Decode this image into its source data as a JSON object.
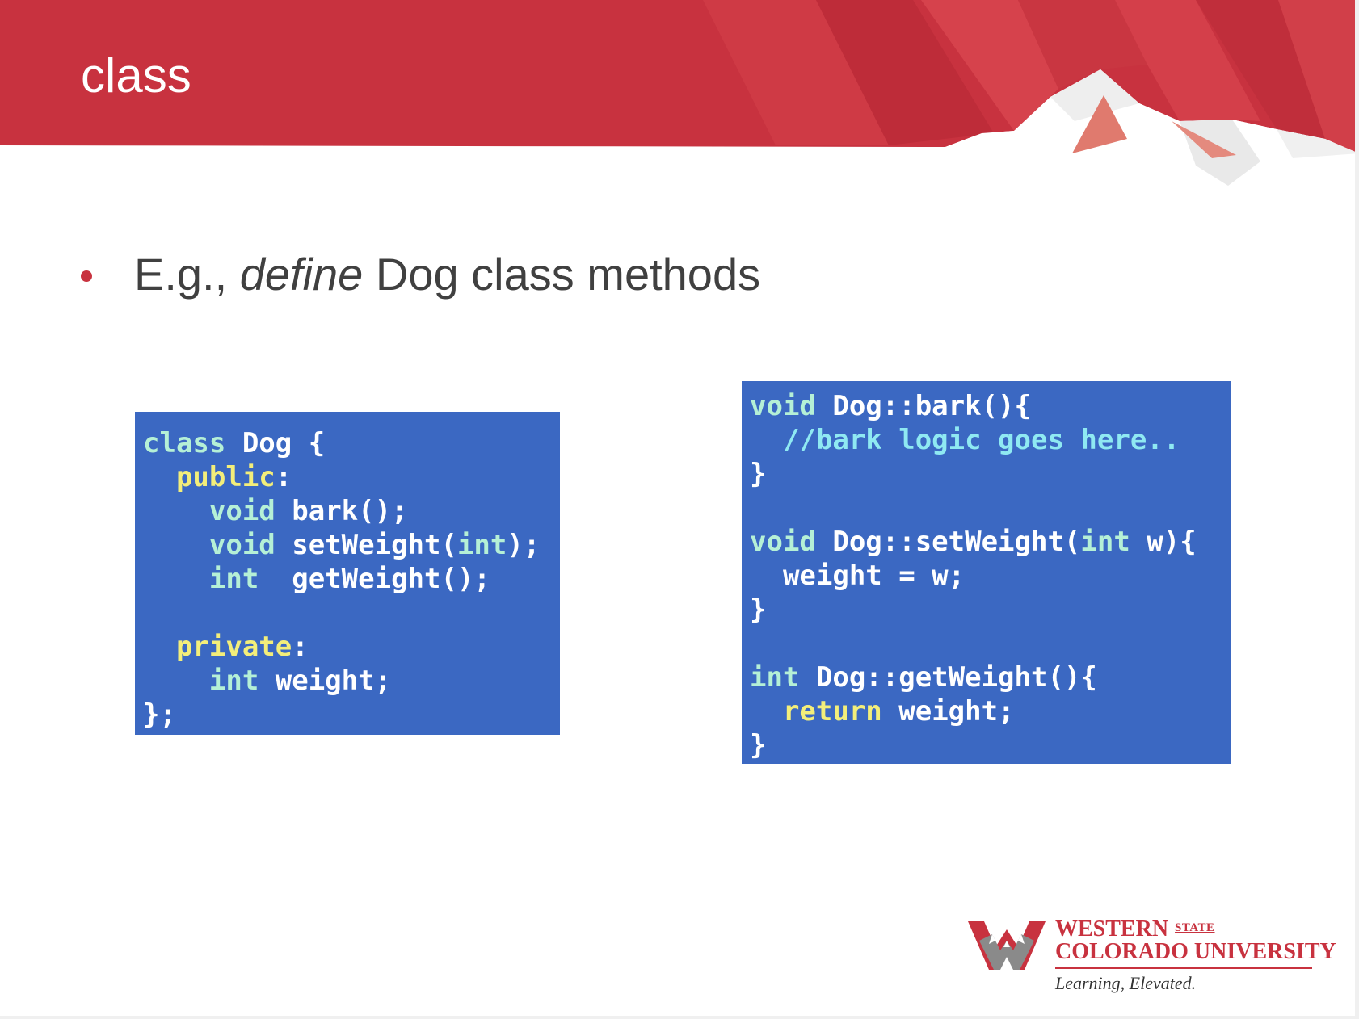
{
  "slide": {
    "title": "class",
    "bullet": {
      "prefix": "E.g., ",
      "emphasis": "define",
      "suffix": " Dog class methods"
    }
  },
  "code_left": {
    "lines": [
      [
        {
          "t": "class",
          "c": "kw"
        },
        {
          "t": " Dog {",
          "c": "pl"
        }
      ],
      [
        {
          "t": "  ",
          "c": "pl"
        },
        {
          "t": "public",
          "c": "ac"
        },
        {
          "t": ":",
          "c": "pl"
        }
      ],
      [
        {
          "t": "    ",
          "c": "pl"
        },
        {
          "t": "void",
          "c": "kw"
        },
        {
          "t": " bark();",
          "c": "pl"
        }
      ],
      [
        {
          "t": "    ",
          "c": "pl"
        },
        {
          "t": "void",
          "c": "kw"
        },
        {
          "t": " setWeight(",
          "c": "pl"
        },
        {
          "t": "int",
          "c": "kw"
        },
        {
          "t": ");",
          "c": "pl"
        }
      ],
      [
        {
          "t": "    ",
          "c": "pl"
        },
        {
          "t": "int",
          "c": "kw"
        },
        {
          "t": "  getWeight();",
          "c": "pl"
        }
      ],
      [],
      [
        {
          "t": "  ",
          "c": "pl"
        },
        {
          "t": "private",
          "c": "ac"
        },
        {
          "t": ":",
          "c": "pl"
        }
      ],
      [
        {
          "t": "    ",
          "c": "pl"
        },
        {
          "t": "int",
          "c": "kw"
        },
        {
          "t": " weight;",
          "c": "pl"
        }
      ],
      [
        {
          "t": "};",
          "c": "pl"
        }
      ]
    ]
  },
  "code_right": {
    "lines": [
      [
        {
          "t": "void",
          "c": "kw"
        },
        {
          "t": " Dog::bark(){",
          "c": "pl"
        }
      ],
      [
        {
          "t": "  ",
          "c": "pl"
        },
        {
          "t": "//bark logic goes here..",
          "c": "cm"
        }
      ],
      [
        {
          "t": "}",
          "c": "pl"
        }
      ],
      [],
      [
        {
          "t": "void",
          "c": "kw"
        },
        {
          "t": " Dog::setWeight(",
          "c": "pl"
        },
        {
          "t": "int",
          "c": "kw"
        },
        {
          "t": " w){",
          "c": "pl"
        }
      ],
      [
        {
          "t": "  weight = w;",
          "c": "pl"
        }
      ],
      [
        {
          "t": "}",
          "c": "pl"
        }
      ],
      [],
      [
        {
          "t": "int",
          "c": "kw"
        },
        {
          "t": " Dog::getWeight(){",
          "c": "pl"
        }
      ],
      [
        {
          "t": "  ",
          "c": "pl"
        },
        {
          "t": "return",
          "c": "ac"
        },
        {
          "t": " weight;",
          "c": "pl"
        }
      ],
      [
        {
          "t": "}",
          "c": "pl"
        }
      ]
    ]
  },
  "logo": {
    "line1": "WESTERN",
    "state": "STATE",
    "line2": "COLORADO UNIVERSITY",
    "tagline": "Learning, Elevated."
  },
  "colors": {
    "banner_red": "#c8323f",
    "code_background": "#3b68c2",
    "keyword": "#b5f0d6",
    "access_specifier": "#f3ee7a",
    "comment": "#8fe9f2",
    "bullet_text": "#404040"
  }
}
